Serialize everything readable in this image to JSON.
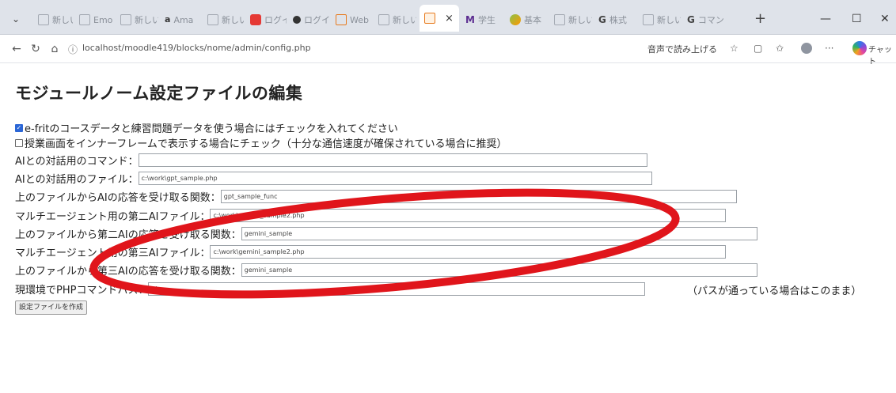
{
  "browser": {
    "tabs": [
      {
        "label": "新しい",
        "icon": "page-icon"
      },
      {
        "label": "Emo",
        "icon": "page-icon"
      },
      {
        "label": "新しい",
        "icon": "page-icon"
      },
      {
        "label": "Ama",
        "icon": "amazon-icon"
      },
      {
        "label": "新しい",
        "icon": "page-icon"
      },
      {
        "label": "ログイ",
        "icon": "red-icon"
      },
      {
        "label": "ログイ",
        "icon": "dot-icon"
      },
      {
        "label": "Web",
        "icon": "moodle-icon"
      },
      {
        "label": "新しい",
        "icon": "page-icon"
      },
      {
        "label": "",
        "icon": "moodle-icon"
      },
      {
        "label": "学生",
        "icon": "m-icon"
      },
      {
        "label": "基本",
        "icon": "bird-icon"
      },
      {
        "label": "新しい",
        "icon": "page-icon"
      },
      {
        "label": "株式",
        "icon": "g-icon"
      },
      {
        "label": "新しい",
        "icon": "page-icon"
      },
      {
        "label": "コマン",
        "icon": "g-icon"
      }
    ],
    "active_tab_close": "×",
    "new_tab": "+",
    "url": "localhost/moodle419/blocks/nome/admin/config.php",
    "read_aloud": "音声で読み上げる",
    "chat_label": "チャット",
    "min": "—",
    "max": "☐",
    "close": "✕"
  },
  "page": {
    "title": "モジュールノーム設定ファイルの編集",
    "checkboxes": [
      {
        "label": "e-fritのコースデータと練習問題データを使う場合にはチェックを入れてください",
        "checked": true
      },
      {
        "label": "授業画面をインナーフレームで表示する場合にチェック（十分な通信速度が確保されている場合に推奨）",
        "checked": false
      }
    ],
    "fields": [
      {
        "label": "AIとの対話用のコマンド：",
        "value": ""
      },
      {
        "label": "AIとの対話用のファイル：",
        "value": "c:\\work\\gpt_sample.php"
      },
      {
        "label": "上のファイルからAIの応答を受け取る関数：",
        "value": "gpt_sample_func"
      },
      {
        "label": "マルチエージェント用の第二AIファイル：",
        "value": "c:\\work\\gemini_sample2.php"
      },
      {
        "label": "上のファイルから第二AIの応答を受け取る関数：",
        "value": "gemini_sample"
      },
      {
        "label": "マルチエージェント用の第三AIファイル：",
        "value": "c:\\work\\gemini_sample2.php"
      },
      {
        "label": "上のファイルから第三AIの応答を受け取る関数：",
        "value": "gemini_sample"
      },
      {
        "label": "現環境でPHPコマンドパス：",
        "value": "php"
      }
    ],
    "php_path_note": "（パスが通っている場合はこのまま）",
    "submit_label": "設定ファイルを作成"
  },
  "annotation": {
    "color": "#e0151b"
  }
}
